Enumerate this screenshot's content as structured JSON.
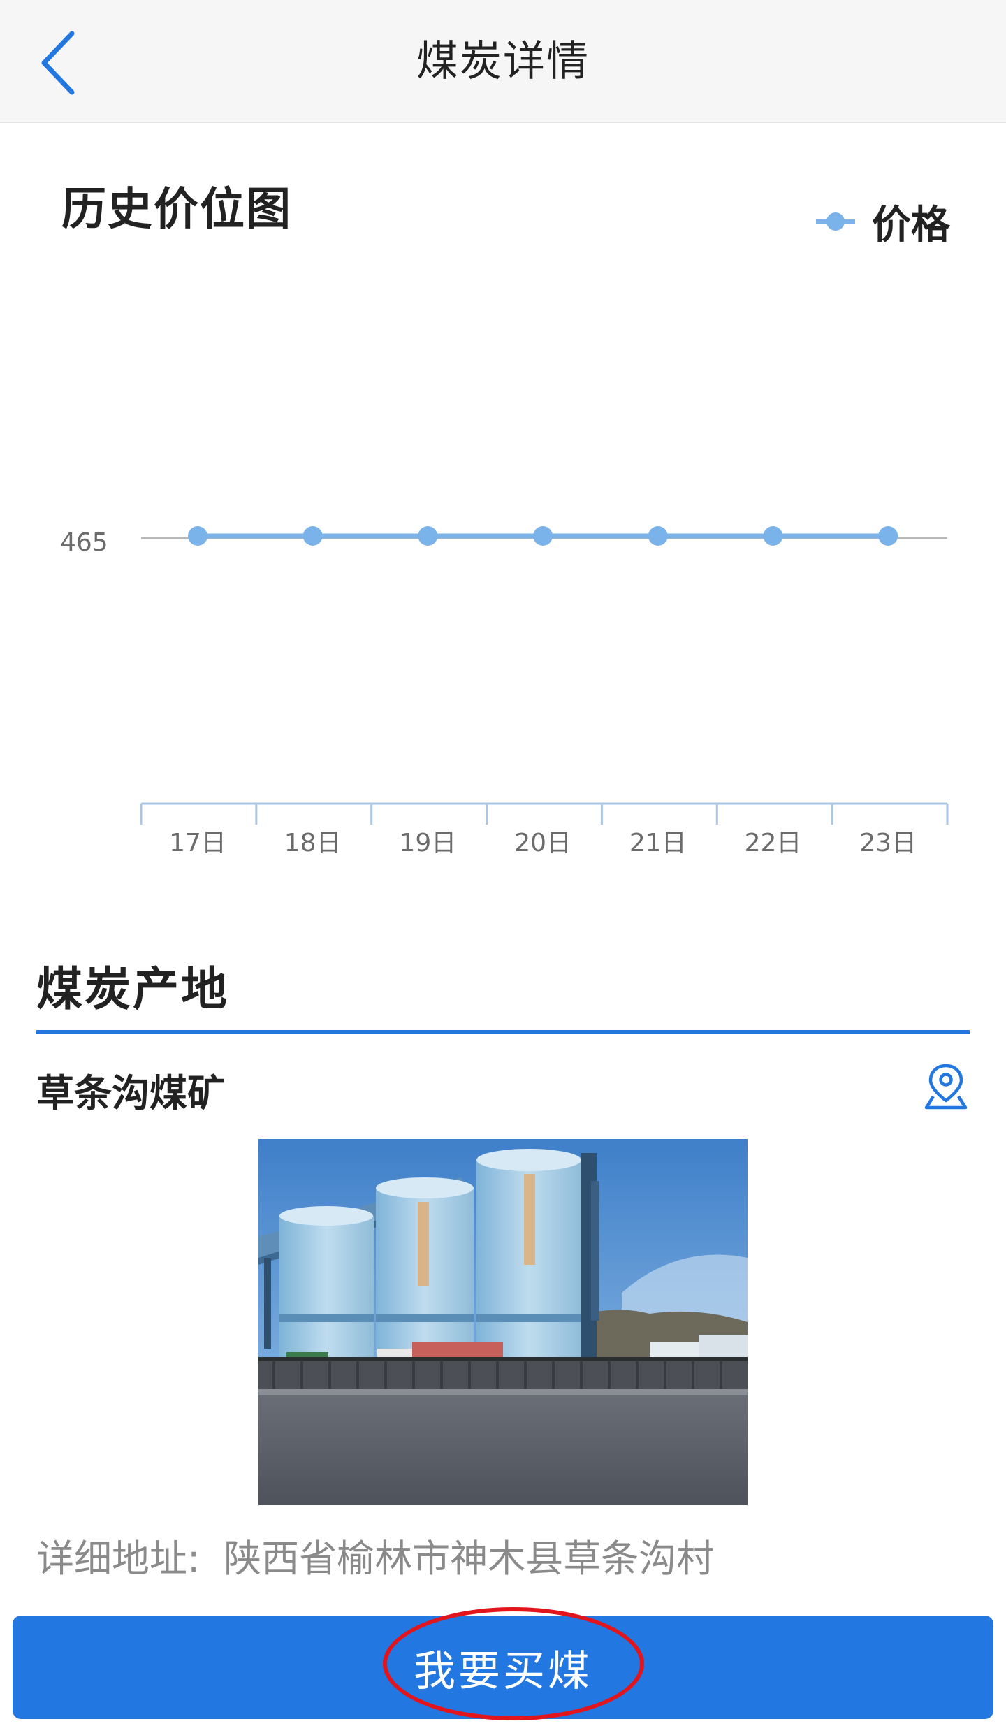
{
  "header": {
    "title": "煤炭详情",
    "back_icon": "chevron-left-icon"
  },
  "chart": {
    "title": "历史价位图",
    "legend": "价格",
    "series_color": "#7ab2ea"
  },
  "chart_data": {
    "type": "line",
    "categories": [
      "17日",
      "18日",
      "19日",
      "20日",
      "21日",
      "22日",
      "23日"
    ],
    "series": [
      {
        "name": "价格",
        "values": [
          465,
          465,
          465,
          465,
          465,
          465,
          465
        ]
      }
    ],
    "y_ticks": [
      "465"
    ],
    "legend_position": "top-right",
    "grid": false
  },
  "origin": {
    "title": "煤炭产地",
    "mine_name": "草条沟煤矿",
    "location_icon": "map-pin-icon",
    "address_label": "详细地址:",
    "address_value": "陕西省榆林市神木县草条沟村"
  },
  "footer": {
    "buy_button_label": "我要买煤"
  },
  "colors": {
    "accent": "#2277e0",
    "annotation": "#e2141c"
  }
}
